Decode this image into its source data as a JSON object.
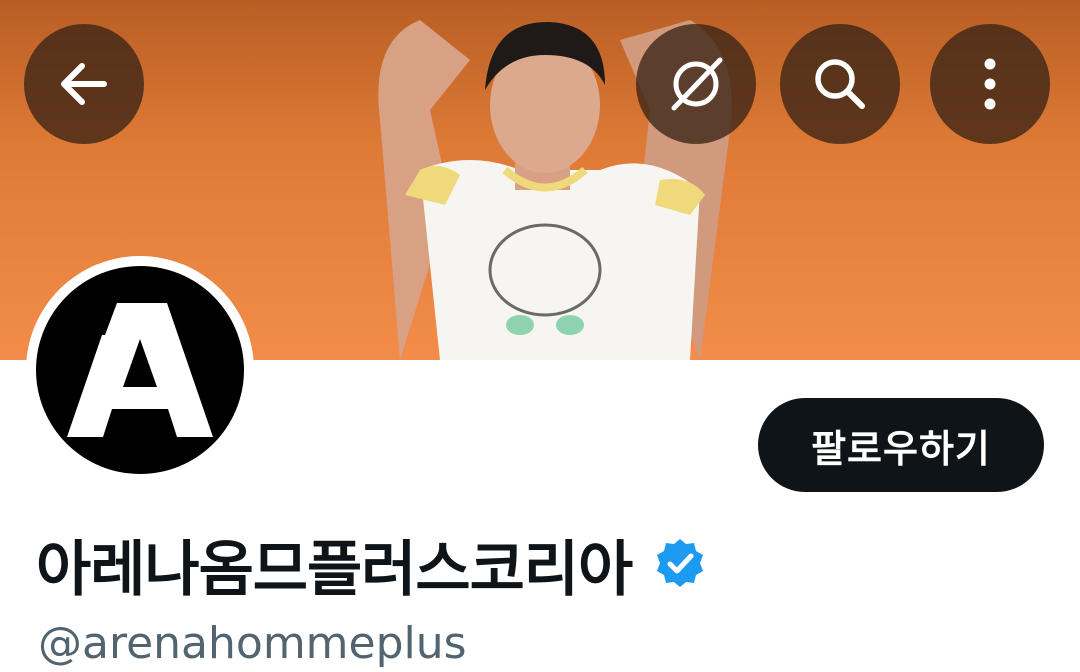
{
  "header": {
    "icons": {
      "back": "arrow-left-icon",
      "grok": "slashed-circle-icon",
      "search": "search-icon",
      "more": "more-vertical-icon"
    },
    "banner_color": "#f38c4a"
  },
  "profile": {
    "display_name": "아레나옴므플러스코리아",
    "handle": "@arenahommeplus",
    "verified": true,
    "verified_color": "#1d9bf0",
    "avatar_icon": "arena-logo-icon",
    "follow_label": "팔로우하기"
  }
}
